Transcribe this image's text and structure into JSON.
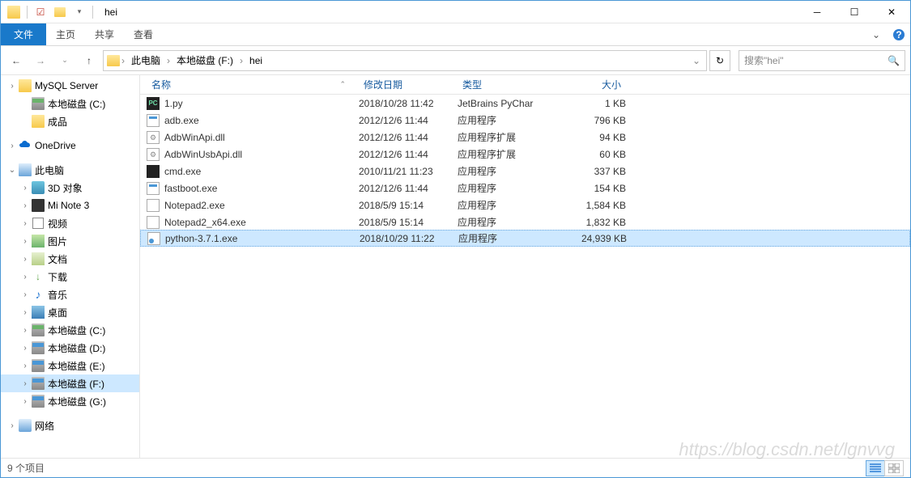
{
  "titlebar": {
    "title": "hei"
  },
  "ribbon": {
    "file": "文件",
    "tabs": [
      "主页",
      "共享",
      "查看"
    ]
  },
  "address": {
    "crumbs": [
      "此电脑",
      "本地磁盘 (F:)",
      "hei"
    ],
    "search_placeholder": "搜索\"hei\""
  },
  "tree": {
    "top": [
      {
        "label": "MySQL Server",
        "icon": "ic-folder"
      },
      {
        "label": "本地磁盘 (C:)",
        "icon": "ic-drive local",
        "indent": true
      },
      {
        "label": "成品",
        "icon": "ic-folder",
        "indent": true
      }
    ],
    "onedrive": {
      "label": "OneDrive"
    },
    "thispc": {
      "label": "此电脑",
      "children": [
        {
          "label": "3D 对象",
          "icon": "ic-3d"
        },
        {
          "label": "Mi Note 3",
          "icon": "ic-phone"
        },
        {
          "label": "视频",
          "icon": "ic-video"
        },
        {
          "label": "图片",
          "icon": "ic-pic"
        },
        {
          "label": "文档",
          "icon": "ic-doc"
        },
        {
          "label": "下载",
          "icon": "ic-dl",
          "glyph": "↓"
        },
        {
          "label": "音乐",
          "icon": "ic-music",
          "glyph": "♪"
        },
        {
          "label": "桌面",
          "icon": "ic-desk"
        },
        {
          "label": "本地磁盘 (C:)",
          "icon": "ic-drive local"
        },
        {
          "label": "本地磁盘 (D:)",
          "icon": "ic-drive"
        },
        {
          "label": "本地磁盘 (E:)",
          "icon": "ic-drive"
        },
        {
          "label": "本地磁盘 (F:)",
          "icon": "ic-drive",
          "selected": true
        },
        {
          "label": "本地磁盘 (G:)",
          "icon": "ic-drive"
        }
      ]
    },
    "network": {
      "label": "网络"
    }
  },
  "columns": {
    "name": "名称",
    "date": "修改日期",
    "type": "类型",
    "size": "大小"
  },
  "files": [
    {
      "name": "1.py",
      "date": "2018/10/28 11:42",
      "type": "JetBrains PyChar",
      "size": "1 KB",
      "icon": "ic-pycharm",
      "glyph": "PC"
    },
    {
      "name": "adb.exe",
      "date": "2012/12/6 11:44",
      "type": "应用程序",
      "size": "796 KB",
      "icon": "ic-exe"
    },
    {
      "name": "AdbWinApi.dll",
      "date": "2012/12/6 11:44",
      "type": "应用程序扩展",
      "size": "94 KB",
      "icon": "ic-dll"
    },
    {
      "name": "AdbWinUsbApi.dll",
      "date": "2012/12/6 11:44",
      "type": "应用程序扩展",
      "size": "60 KB",
      "icon": "ic-dll"
    },
    {
      "name": "cmd.exe",
      "date": "2010/11/21 11:23",
      "type": "应用程序",
      "size": "337 KB",
      "icon": "ic-cmd"
    },
    {
      "name": "fastboot.exe",
      "date": "2012/12/6 11:44",
      "type": "应用程序",
      "size": "154 KB",
      "icon": "ic-exe"
    },
    {
      "name": "Notepad2.exe",
      "date": "2018/5/9 15:14",
      "type": "应用程序",
      "size": "1,584 KB",
      "icon": "ic-note"
    },
    {
      "name": "Notepad2_x64.exe",
      "date": "2018/5/9 15:14",
      "type": "应用程序",
      "size": "1,832 KB",
      "icon": "ic-note"
    },
    {
      "name": "python-3.7.1.exe",
      "date": "2018/10/29 11:22",
      "type": "应用程序",
      "size": "24,939 KB",
      "icon": "ic-py",
      "selected": true
    }
  ],
  "status": {
    "count": "9 个项目"
  },
  "watermark": "https://blog.csdn.net/lgnvvg"
}
